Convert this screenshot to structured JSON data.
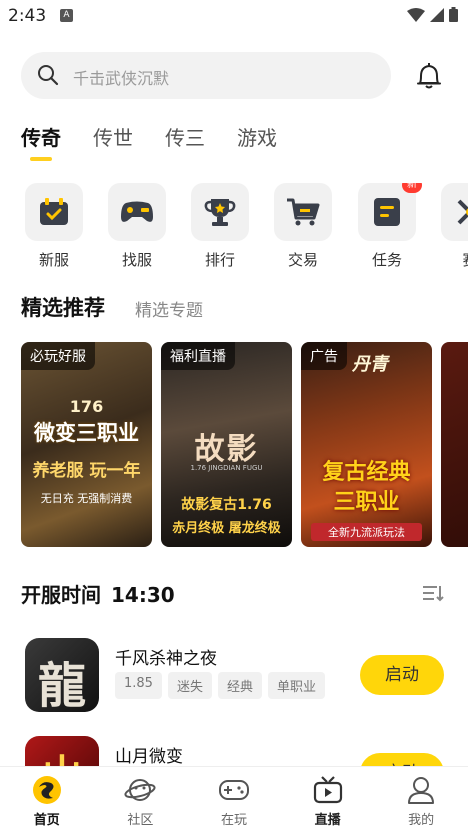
{
  "status": {
    "time": "2:43",
    "notif_glyph": "A"
  },
  "search": {
    "placeholder": "千击武侠沉默"
  },
  "tabs": [
    {
      "label": "传奇",
      "active": true
    },
    {
      "label": "传世"
    },
    {
      "label": "传三"
    },
    {
      "label": "游戏"
    }
  ],
  "categories": [
    {
      "label": "新服",
      "icon": "calendar-icon"
    },
    {
      "label": "找服",
      "icon": "gamepad-icon"
    },
    {
      "label": "排行",
      "icon": "trophy-icon"
    },
    {
      "label": "交易",
      "icon": "cart-icon"
    },
    {
      "label": "任务",
      "icon": "task-icon",
      "badge": "新"
    },
    {
      "label": "赛",
      "icon": "match-icon"
    }
  ],
  "featured": {
    "title": "精选推荐",
    "subtitle": "精选专题"
  },
  "cards": [
    {
      "tag": "必玩好服",
      "line1": "176",
      "line2": "微变三职业",
      "line3": "养老服 玩一年",
      "line4": "无日充 无强制消费"
    },
    {
      "tag": "福利直播",
      "line1": "故影",
      "line2": "1.76 JINGDIAN FUGU",
      "line3": "故影复古1.76",
      "line4": "赤月终极 屠龙终极"
    },
    {
      "tag": "广告",
      "line1": "丹青",
      "line2": "复古经典",
      "line3": "三职业",
      "line4": "全新九流派玩法"
    }
  ],
  "open_time": {
    "label": "开服时间",
    "time": "14:30"
  },
  "games": [
    {
      "name": "千风杀神之夜",
      "chips": [
        "1.85",
        "迷失",
        "经典",
        "单职业"
      ],
      "button": "启动",
      "icon_char": "龍"
    },
    {
      "name": "山月微变",
      "chips": [],
      "button": "启动",
      "icon_char": "山"
    }
  ],
  "nav": [
    {
      "label": "首页",
      "icon": "home-icon",
      "active": true
    },
    {
      "label": "社区",
      "icon": "community-icon"
    },
    {
      "label": "在玩",
      "icon": "gamepad-icon"
    },
    {
      "label": "直播",
      "icon": "tv-icon"
    },
    {
      "label": "我的",
      "icon": "profile-icon"
    }
  ],
  "colors": {
    "accent": "#ffd60a",
    "badge": "#ff3b30"
  }
}
